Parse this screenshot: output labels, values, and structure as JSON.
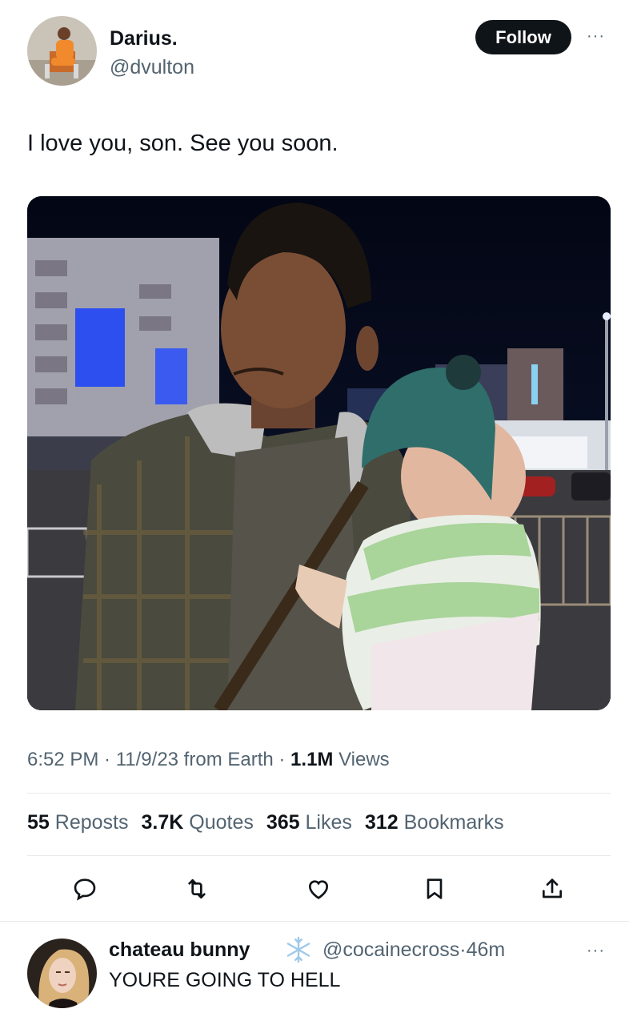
{
  "tweet": {
    "author": {
      "name": "Darius.",
      "handle": "@dvulton"
    },
    "follow_label": "Follow",
    "more_label": "···",
    "text": "I love you, son. See you soon.",
    "time": "6:52 PM",
    "sep1": " · ",
    "date": "11/9/23",
    "source": " from Earth",
    "sep2": " · ",
    "views_count": "1.1M",
    "views_label": " Views",
    "stats": {
      "reposts_count": "55",
      "reposts_label": "Reposts",
      "quotes_count": "3.7K",
      "quotes_label": "Quotes",
      "likes_count": "365",
      "likes_label": "Likes",
      "bookmarks_count": "312",
      "bookmarks_label": "Bookmarks"
    },
    "actions": [
      "reply-icon",
      "repost-icon",
      "like-icon",
      "bookmark-icon",
      "share-icon"
    ]
  },
  "reply": {
    "name": "chateau bunny",
    "badge": "snowflake-icon",
    "handle": "@cocainecross",
    "sep": "·",
    "time": "46m",
    "more_label": "···",
    "text": "YOURE GOING TO HELL"
  },
  "colors": {
    "text": "#0f1419",
    "secondary": "#536471",
    "divider": "#e6e9ec",
    "button": "#0f1419"
  }
}
